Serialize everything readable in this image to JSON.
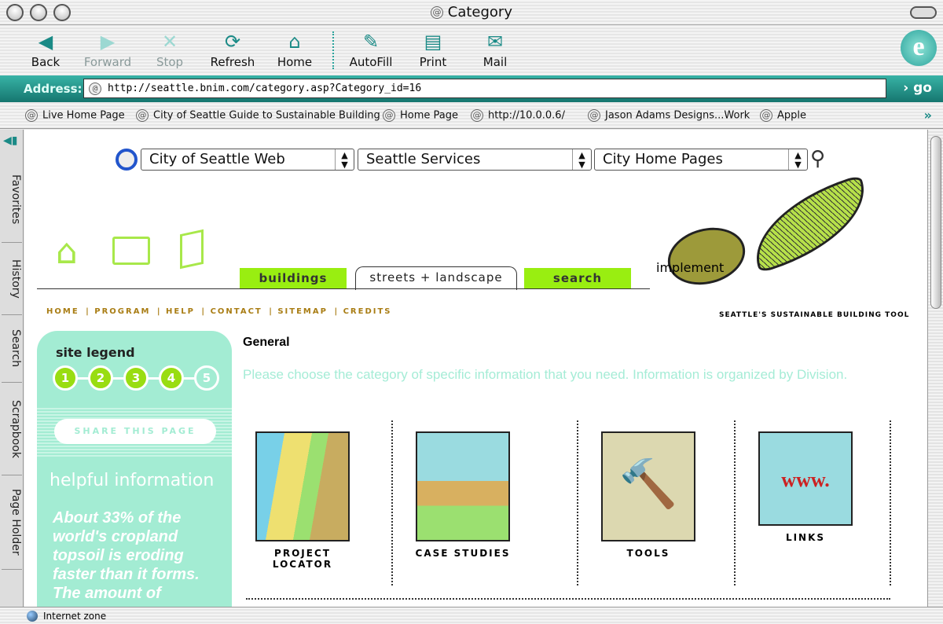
{
  "window": {
    "title": "Category"
  },
  "toolbar": [
    {
      "label": "Back",
      "icon": "back-arrow-icon",
      "enabled": true
    },
    {
      "label": "Forward",
      "icon": "forward-arrow-icon",
      "enabled": false
    },
    {
      "label": "Stop",
      "icon": "stop-icon",
      "enabled": false
    },
    {
      "label": "Refresh",
      "icon": "refresh-icon",
      "enabled": true
    },
    {
      "label": "Home",
      "icon": "home-icon",
      "enabled": true
    },
    {
      "label": "AutoFill",
      "icon": "autofill-icon",
      "enabled": true
    },
    {
      "label": "Print",
      "icon": "print-icon",
      "enabled": true
    },
    {
      "label": "Mail",
      "icon": "mail-icon",
      "enabled": true
    }
  ],
  "address": {
    "label": "Address:",
    "url": "http://seattle.bnim.com/category.asp?Category_id=16",
    "go": "› go"
  },
  "favorites": [
    "Live Home Page",
    "City of Seattle Guide to Sustainable Building",
    "Home Page",
    "http://10.0.0.6/",
    "Jason Adams Designs...Work",
    "Apple"
  ],
  "side_tabs": [
    "Favorites",
    "History",
    "Search",
    "Scrapbook",
    "Page Holder"
  ],
  "status": "Internet zone",
  "page": {
    "selects": [
      "City of Seattle Web",
      "Seattle Services",
      "City Home Pages"
    ],
    "tabs": [
      {
        "label": "buildings",
        "active": false
      },
      {
        "label": "streets + landscape",
        "active": true
      },
      {
        "label": "search",
        "active": false
      }
    ],
    "logo": {
      "name": "implement",
      "tagline": "SEATTLE'S SUSTAINABLE BUILDING TOOL"
    },
    "links": [
      "HOME",
      "PROGRAM",
      "HELP",
      "CONTACT",
      "SITEMAP",
      "CREDITS"
    ],
    "legend": {
      "title": "site legend",
      "steps": [
        "1",
        "2",
        "3",
        "4",
        "5"
      ],
      "completed": 4,
      "share": "SHARE THIS PAGE",
      "helpful_title": "helpful information",
      "fact": "About 33% of the world's cropland topsoil is eroding faster than it forms. The amount of"
    },
    "heading": "General",
    "intro": "Please choose the category of specific information that you need. Information is organized by Division.",
    "categories": [
      "PROJECT LOCATOR",
      "CASE STUDIES",
      "TOOLS",
      "LINKS"
    ],
    "colors": {
      "accent": "#99dd11",
      "mint": "#a3ecd3",
      "link": "#a97d14",
      "chrome_teal": "#1a8a86"
    }
  }
}
